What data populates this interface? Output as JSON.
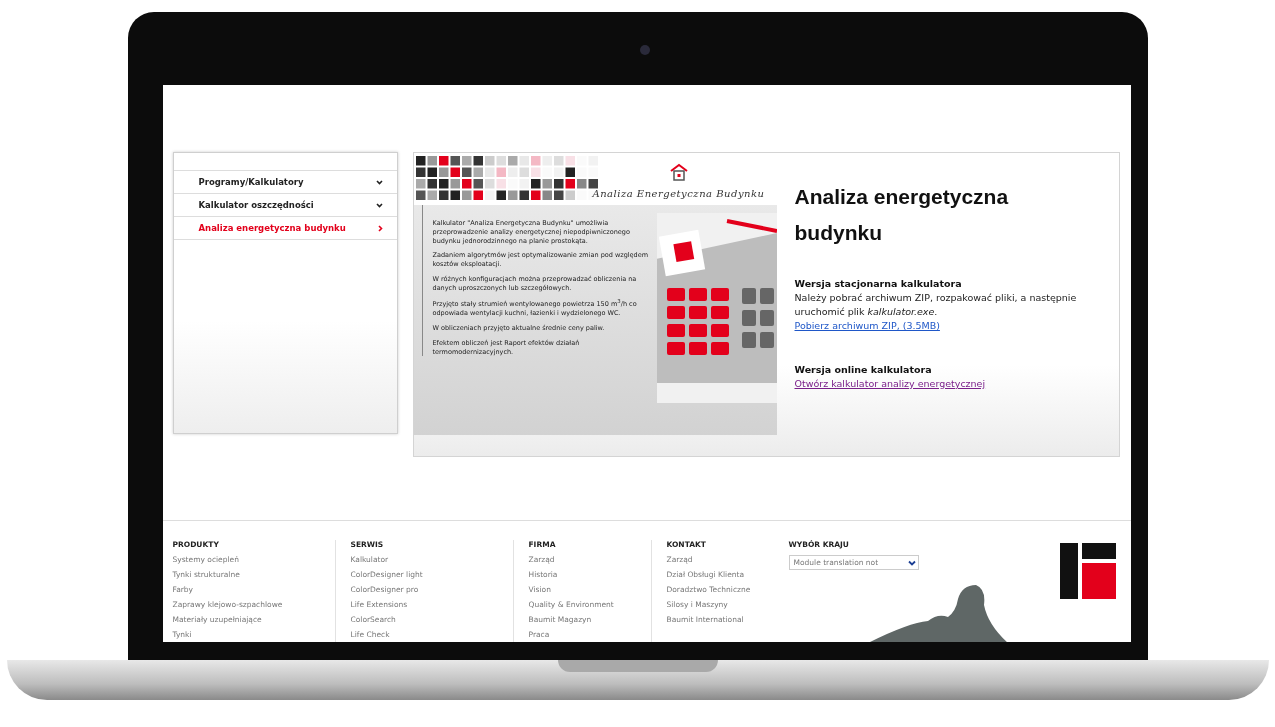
{
  "sidebar": {
    "items": [
      {
        "label": "Programy/Kalkulatory",
        "kind": "expand",
        "selected": false
      },
      {
        "label": "Kalkulator oszczędności",
        "kind": "expand",
        "selected": false
      },
      {
        "label": "Analiza energetyczna budynku",
        "kind": "arrow",
        "selected": true
      }
    ]
  },
  "banner": {
    "title": "Analiza Energetyczna Budynku",
    "bullets": [
      "Kalkulator \"Analiza Energetyczna Budynku\" umożliwia przeprowadzenie analizy energetycznej niepodpiwniczonego budynku jednorodzinnego na planie prostokąta.",
      "Zadaniem algorytmów jest optymalizowanie zmian pod względem kosztów eksploatacji.",
      "W różnych konfiguracjach można przeprowadzać obliczenia na danych uproszczonych lub szczegółowych.",
      "Przyjęto stały strumień wentylowanego powietrza 150 m$^{3}$/h co odpowiada wentylacji kuchni, łazienki i wydzielonego WC.",
      "W obliczeniach przyjęto aktualne średnie ceny paliw.",
      "Efektem obliczeń jest Raport efektów działań termomodernizacyjnych."
    ]
  },
  "content": {
    "title": "Analiza energetyczna budynku",
    "sections": [
      {
        "heading": "Wersja stacjonarna kalkulatora",
        "text": "Należy pobrać archiwum ZIP, rozpakować pliki, a następnie uruchomić plik *kalkulator.exe*.",
        "link": "Pobierz archiwum ZIP, (3.5MB)",
        "visited": false
      },
      {
        "heading": "Wersja online kalkulatora",
        "link": "Otwórz kalkulator analizy energetycznej",
        "visited": true
      }
    ]
  },
  "footer": {
    "columns": [
      {
        "heading": "PRODUKTY",
        "links": [
          "Systemy ociepleń",
          "Tynki strukturalne",
          "Farby",
          "Zaprawy klejowo-szpachlowe",
          "Materiały uzupełniające",
          "Tynki"
        ]
      },
      {
        "heading": "SERWIS",
        "links": [
          "Kalkulator",
          "ColorDesigner light",
          "ColorDesigner pro",
          "Life Extensions",
          "ColorSearch",
          "Life Check"
        ]
      },
      {
        "heading": "FIRMA",
        "links": [
          "Zarząd",
          "Historia",
          "Vision",
          "Quality & Environment",
          "Baumit Magazyn",
          "Praca"
        ]
      },
      {
        "heading": "KONTAKT",
        "links": [
          "Zarząd",
          "Dział Obsługi Klienta",
          "Doradztwo Techniczne",
          "Silosy i Maszyny",
          "Baumit International"
        ]
      }
    ],
    "country": {
      "heading": "WYBÓR KRAJU",
      "value": "Module translation not"
    }
  }
}
